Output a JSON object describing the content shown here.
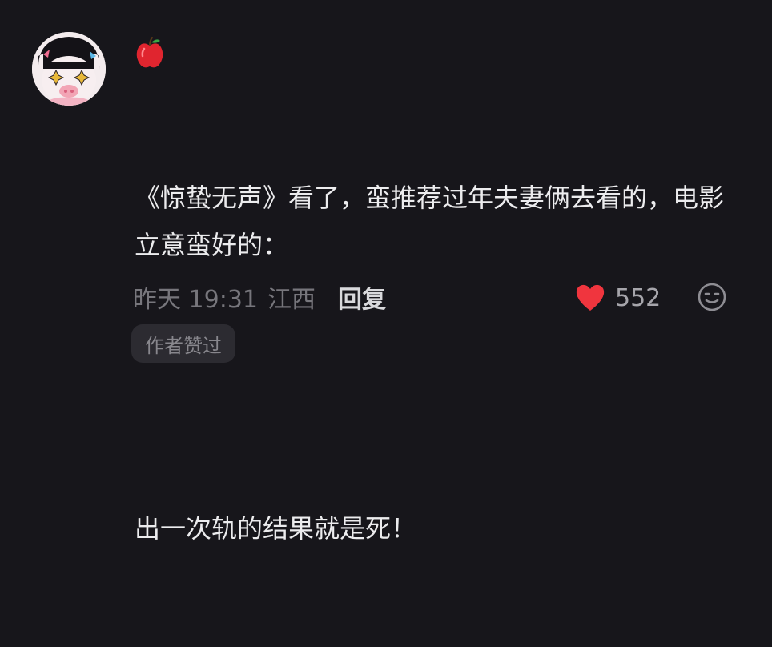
{
  "comment": {
    "username_icon": "apple-emoji-icon",
    "paragraphs": [
      "《惊蛰无声》看了，蛮推荐过年夫妻俩去看的，电影立意蛮好的：",
      "",
      "出一次轨的结果就是死！"
    ],
    "time": "昨天 19:31",
    "location": "江西",
    "reply_label": "回复",
    "like_count": "552",
    "author_badge": "作者赞过"
  },
  "colors": {
    "background": "#17161b",
    "text": "#ececee",
    "meta": "#77767c",
    "like_heart": "#f0353e",
    "badge_bg": "#2c2b31"
  }
}
